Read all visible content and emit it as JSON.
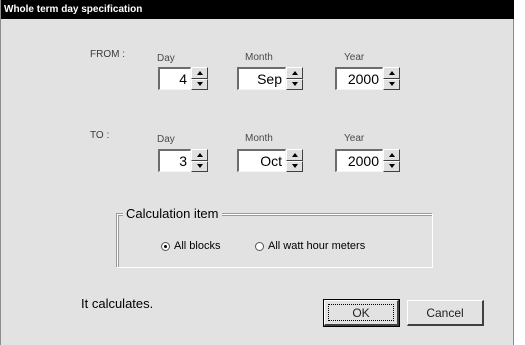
{
  "window": {
    "title": "Whole term day specification"
  },
  "columns": {
    "day": "Day",
    "month": "Month",
    "year": "Year"
  },
  "from": {
    "label": "FROM :",
    "day": "4",
    "month": "Sep",
    "year": "2000"
  },
  "to": {
    "label": "TO :",
    "day": "3",
    "month": "Oct",
    "year": "2000"
  },
  "calc": {
    "title": "Calculation item",
    "options": [
      {
        "label": "All blocks",
        "selected": true
      },
      {
        "label": "All watt hour meters",
        "selected": false
      }
    ]
  },
  "status": {
    "message": "It calculates."
  },
  "buttons": {
    "ok": "OK",
    "cancel": "Cancel"
  }
}
